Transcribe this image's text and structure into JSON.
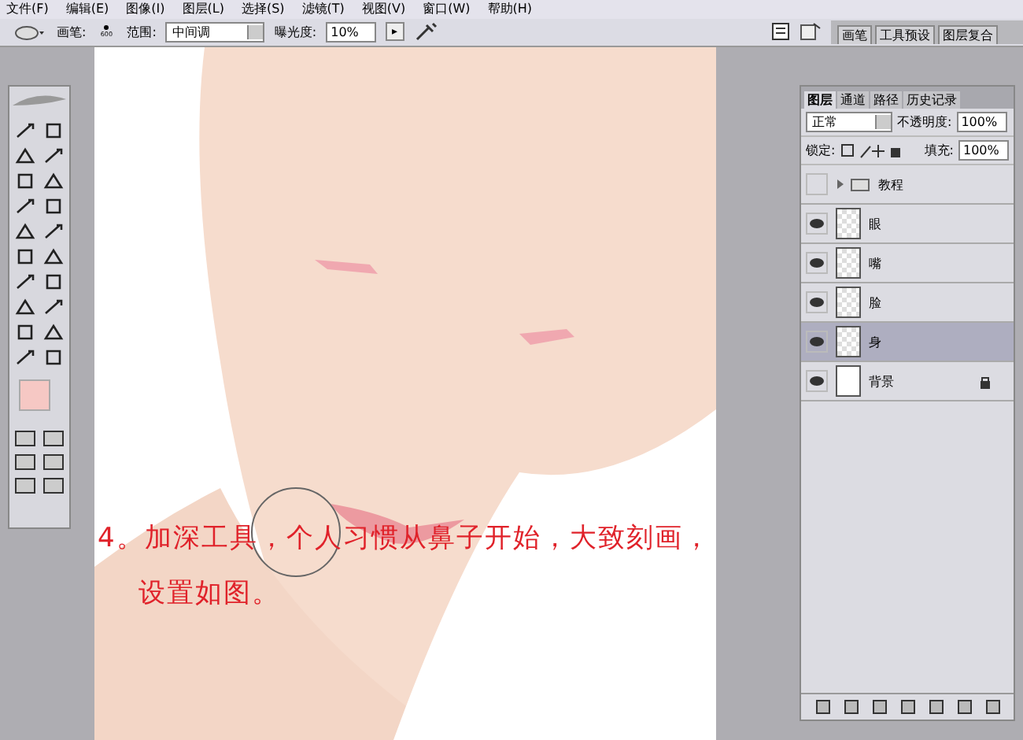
{
  "menu": [
    "文件(F)",
    "编辑(E)",
    "图像(I)",
    "图层(L)",
    "选择(S)",
    "滤镜(T)",
    "视图(V)",
    "窗口(W)",
    "帮助(H)"
  ],
  "options": {
    "brush_label": "画笔:",
    "brush_size": "600",
    "range_label": "范围:",
    "range_value": "中间调",
    "exposure_label": "曝光度:",
    "exposure_value": "10%",
    "stepper": "▸"
  },
  "palette_tabs": [
    {
      "label": "画笔"
    },
    {
      "label": "工具预设"
    },
    {
      "label": "图层复合"
    }
  ],
  "layers_panel": {
    "tabs": [
      {
        "label": "图层",
        "selected": true
      },
      {
        "label": "通道",
        "selected": false
      },
      {
        "label": "路径",
        "selected": false
      },
      {
        "label": "历史记录",
        "selected": false
      }
    ],
    "blend_mode": "正常",
    "opacity_label": "不透明度:",
    "opacity_value": "100%",
    "lock_label": "锁定:",
    "fill_label": "填充:",
    "fill_value": "100%",
    "layers": [
      {
        "name": "教程",
        "kind": "group",
        "visible": false,
        "selected": false,
        "locked": false
      },
      {
        "name": "眼",
        "kind": "layer",
        "visible": true,
        "selected": false,
        "locked": false
      },
      {
        "name": "嘴",
        "kind": "layer",
        "visible": true,
        "selected": false,
        "locked": false
      },
      {
        "name": "脸",
        "kind": "layer",
        "visible": true,
        "selected": false,
        "locked": false
      },
      {
        "name": "身",
        "kind": "layer",
        "visible": true,
        "selected": true,
        "locked": false
      },
      {
        "name": "背景",
        "kind": "background",
        "visible": true,
        "selected": false,
        "locked": true
      }
    ]
  },
  "caption": {
    "lines": [
      "4。加深工具，个人习惯从鼻子开始，大致刻画，",
      "设置如图。"
    ]
  }
}
